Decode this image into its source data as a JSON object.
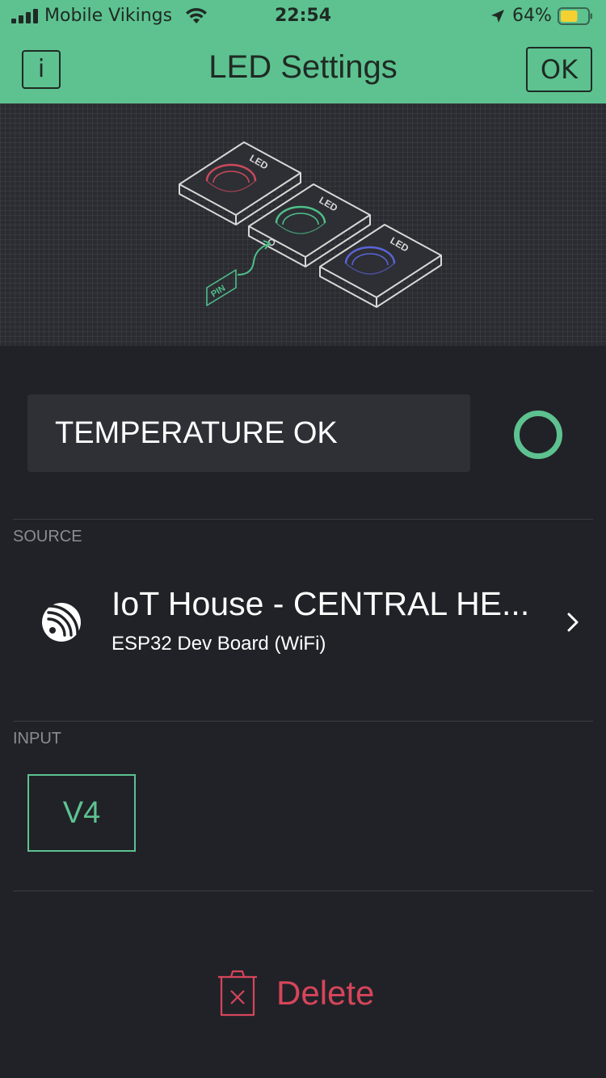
{
  "status_bar": {
    "carrier": "Mobile Vikings",
    "time": "22:54",
    "battery": "64%",
    "battery_level": 0.64
  },
  "header": {
    "info_label": "i",
    "title": "LED Settings",
    "ok_label": "OK"
  },
  "illustration": {
    "led_label": "LED",
    "pin_label": "PIN",
    "led_colors": [
      "#c9495b",
      "#4fbf8a",
      "#5b63d6"
    ]
  },
  "preview": {
    "label": "TEMPERATURE OK",
    "led_color": "#5dc290"
  },
  "source": {
    "section_label": "SOURCE",
    "device_name": "IoT House - CENTRAL HE...",
    "device_type": "ESP32 Dev Board (WiFi)",
    "icon": "espressif-icon"
  },
  "input": {
    "section_label": "INPUT",
    "pin": "V4"
  },
  "actions": {
    "delete_label": "Delete"
  },
  "colors": {
    "accent": "#5dc290",
    "danger": "#d6455b",
    "background": "#212227"
  }
}
